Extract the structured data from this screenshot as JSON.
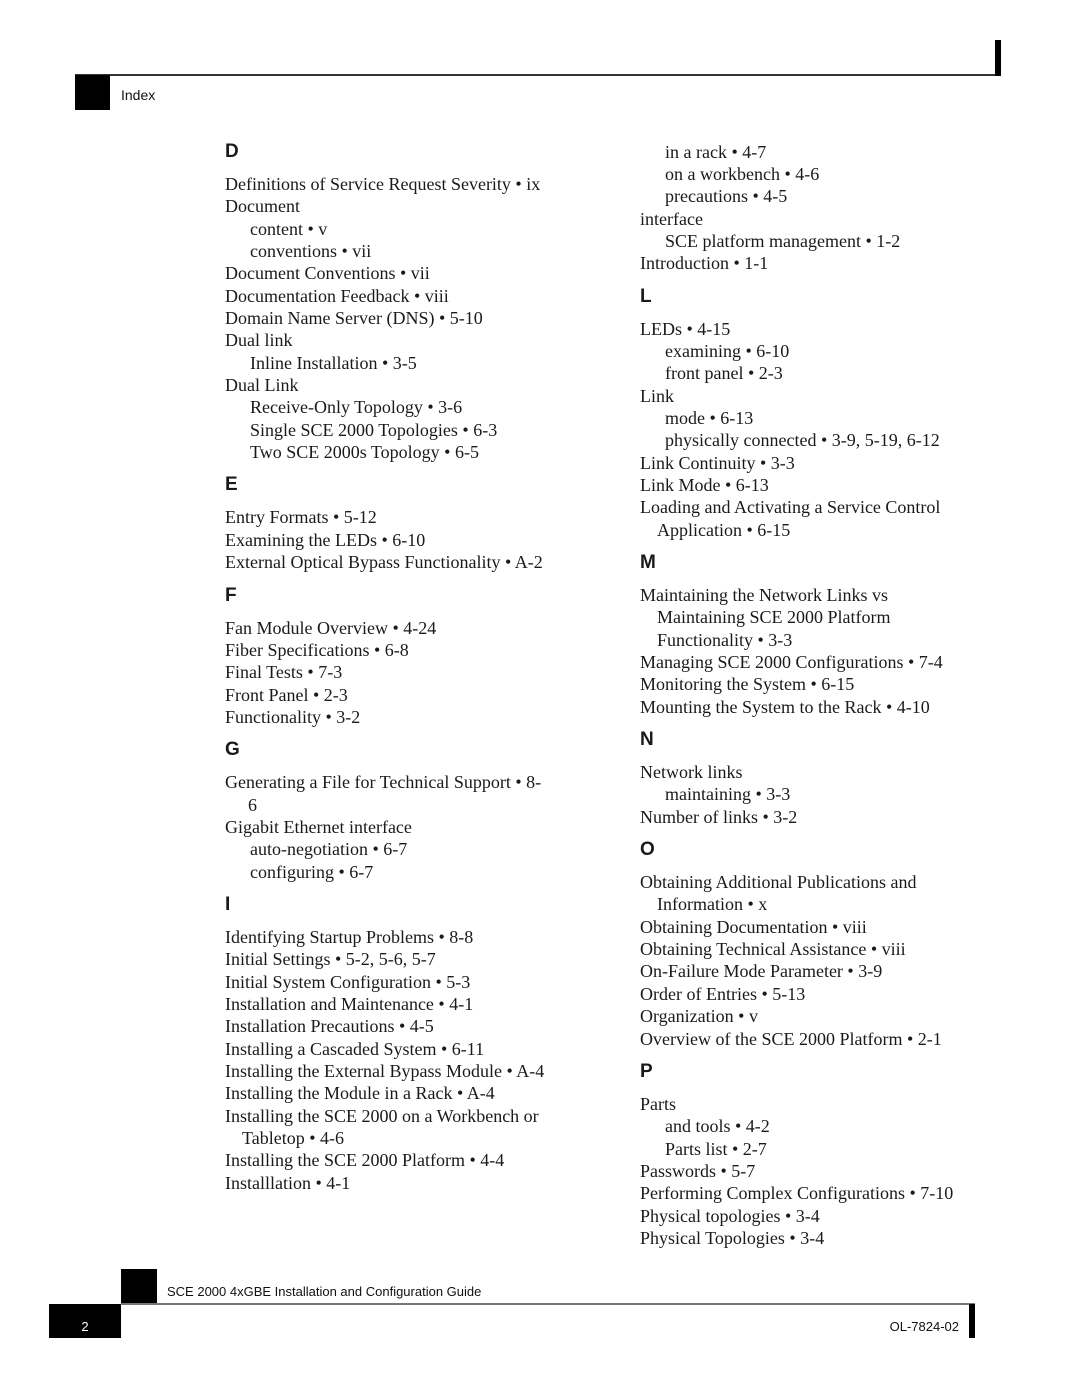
{
  "header": {
    "section_label": "Index"
  },
  "left_column": [
    {
      "type": "letter",
      "text": "D"
    },
    {
      "type": "entry",
      "text": "Definitions of Service Request Severity • ix"
    },
    {
      "type": "entry",
      "text": "Document"
    },
    {
      "type": "sub",
      "text": "content • v"
    },
    {
      "type": "sub",
      "text": "conventions • vii"
    },
    {
      "type": "entry",
      "text": "Document Conventions • vii"
    },
    {
      "type": "entry",
      "text": "Documentation Feedback • viii"
    },
    {
      "type": "entry",
      "text": "Domain Name Server (DNS) • 5-10"
    },
    {
      "type": "entry",
      "text": "Dual link"
    },
    {
      "type": "sub",
      "text": "Inline Installation • 3-5"
    },
    {
      "type": "entry",
      "text": "Dual Link"
    },
    {
      "type": "sub",
      "text": "Receive-Only Topology • 3-6"
    },
    {
      "type": "sub",
      "text": "Single SCE 2000 Topologies • 6-3"
    },
    {
      "type": "sub",
      "text": "Two SCE 2000s Topology • 6-5"
    },
    {
      "type": "letter",
      "text": "E"
    },
    {
      "type": "entry",
      "text": "Entry Formats • 5-12"
    },
    {
      "type": "entry",
      "text": "Examining the LEDs • 6-10"
    },
    {
      "type": "entry",
      "text": "External Optical Bypass Functionality • A-2"
    },
    {
      "type": "letter",
      "text": "F"
    },
    {
      "type": "entry",
      "text": "Fan Module Overview • 4-24"
    },
    {
      "type": "entry",
      "text": "Fiber Specifications • 6-8"
    },
    {
      "type": "entry",
      "text": "Final Tests • 7-3"
    },
    {
      "type": "entry",
      "text": "Front Panel • 2-3"
    },
    {
      "type": "entry",
      "text": "Functionality • 3-2"
    },
    {
      "type": "letter",
      "text": "G"
    },
    {
      "type": "wrap-num",
      "text": "Generating a File for Technical Support • 8- 6"
    },
    {
      "type": "entry",
      "text": "Gigabit Ethernet interface"
    },
    {
      "type": "sub",
      "text": "auto-negotiation • 6-7"
    },
    {
      "type": "sub",
      "text": "configuring • 6-7"
    },
    {
      "type": "letter",
      "text": "I"
    },
    {
      "type": "entry",
      "text": "Identifying Startup Problems • 8-8"
    },
    {
      "type": "entry",
      "text": "Initial Settings • 5-2, 5-6, 5-7"
    },
    {
      "type": "entry",
      "text": "Initial System Configuration • 5-3"
    },
    {
      "type": "entry",
      "text": "Installation and Maintenance • 4-1"
    },
    {
      "type": "entry",
      "text": "Installation Precautions • 4-5"
    },
    {
      "type": "entry",
      "text": "Installing a Cascaded System • 6-11"
    },
    {
      "type": "entry",
      "text": "Installing the External Bypass Module • A-4"
    },
    {
      "type": "entry",
      "text": "Installing the Module in a Rack • A-4"
    },
    {
      "type": "wrap",
      "text": "Installing the SCE 2000 on a Workbench or Tabletop • 4-6"
    },
    {
      "type": "entry",
      "text": "Installing the SCE 2000 Platform • 4-4"
    },
    {
      "type": "entry",
      "text": "Installlation • 4-1"
    }
  ],
  "right_column": [
    {
      "type": "sub",
      "text": "in a rack • 4-7"
    },
    {
      "type": "sub",
      "text": "on a workbench • 4-6"
    },
    {
      "type": "sub",
      "text": "precautions • 4-5"
    },
    {
      "type": "entry",
      "text": "interface"
    },
    {
      "type": "sub",
      "text": "SCE platform management • 1-2"
    },
    {
      "type": "entry",
      "text": "Introduction • 1-1"
    },
    {
      "type": "letter",
      "text": "L"
    },
    {
      "type": "entry",
      "text": "LEDs • 4-15"
    },
    {
      "type": "sub",
      "text": "examining • 6-10"
    },
    {
      "type": "sub",
      "text": "front panel • 2-3"
    },
    {
      "type": "entry",
      "text": "Link"
    },
    {
      "type": "sub",
      "text": "mode • 6-13"
    },
    {
      "type": "sub",
      "text": "physically connected • 3-9, 5-19, 6-12"
    },
    {
      "type": "entry",
      "text": "Link Continuity • 3-3"
    },
    {
      "type": "entry",
      "text": "Link Mode • 6-13"
    },
    {
      "type": "wrap",
      "text": "Loading and Activating a Service Control Application • 6-15"
    },
    {
      "type": "letter",
      "text": "M"
    },
    {
      "type": "wrap",
      "text": "Maintaining the Network Links vs Maintaining SCE 2000 Platform Functionality • 3-3"
    },
    {
      "type": "entry",
      "text": "Managing SCE 2000 Configurations • 7-4"
    },
    {
      "type": "entry",
      "text": "Monitoring the System • 6-15"
    },
    {
      "type": "entry",
      "text": "Mounting the System to the Rack • 4-10"
    },
    {
      "type": "letter",
      "text": "N"
    },
    {
      "type": "entry",
      "text": "Network links"
    },
    {
      "type": "sub",
      "text": "maintaining • 3-3"
    },
    {
      "type": "entry",
      "text": "Number of links • 3-2"
    },
    {
      "type": "letter",
      "text": "O"
    },
    {
      "type": "wrap",
      "text": "Obtaining Additional Publications and Information • x"
    },
    {
      "type": "entry",
      "text": "Obtaining Documentation • viii"
    },
    {
      "type": "entry",
      "text": "Obtaining Technical Assistance • viii"
    },
    {
      "type": "entry",
      "text": "On-Failure Mode Parameter • 3-9"
    },
    {
      "type": "entry",
      "text": "Order of Entries • 5-13"
    },
    {
      "type": "entry",
      "text": "Organization • v"
    },
    {
      "type": "entry",
      "text": "Overview of the SCE 2000 Platform • 2-1"
    },
    {
      "type": "letter",
      "text": "P"
    },
    {
      "type": "entry",
      "text": "Parts"
    },
    {
      "type": "sub",
      "text": "and tools • 4-2"
    },
    {
      "type": "sub",
      "text": "Parts list • 2-7"
    },
    {
      "type": "entry",
      "text": "Passwords • 5-7"
    },
    {
      "type": "entry",
      "text": "Performing Complex Configurations • 7-10"
    },
    {
      "type": "entry",
      "text": "Physical topologies • 3-4"
    },
    {
      "type": "entry",
      "text": "Physical Topologies • 3-4"
    }
  ],
  "footer": {
    "guide_title": "SCE 2000 4xGBE Installation and Configuration Guide",
    "page_number": "2",
    "doc_number": "OL-7824-02"
  }
}
